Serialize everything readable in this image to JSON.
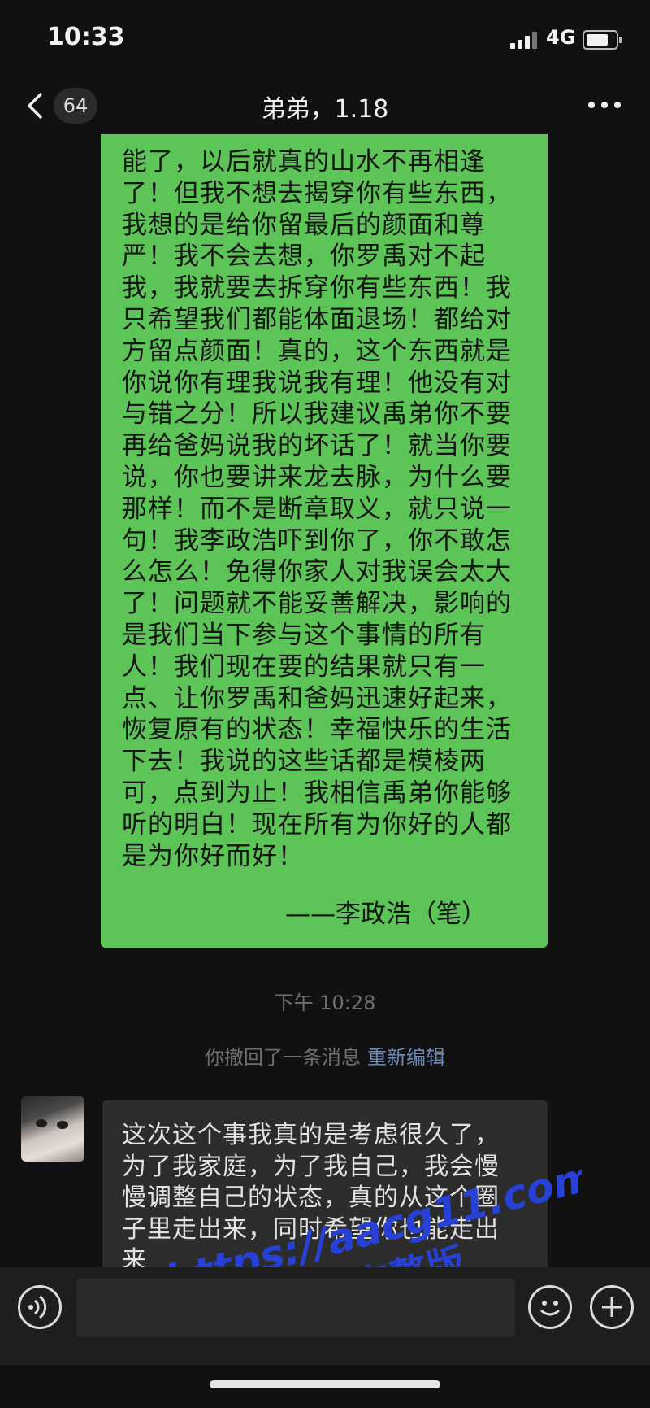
{
  "status_bar": {
    "time": "10:33",
    "network": "4G"
  },
  "nav": {
    "back_count": "64",
    "title": "弟弟，1.18"
  },
  "sent_message": {
    "lines": [
      "能了，以后就真的山水不再相逢",
      "了！但我不想去揭穿你有些东西，",
      "我想的是给你留最后的颜面和尊",
      "严！我不会去想，你罗禹对不起",
      "我，我就要去拆穿你有些东西！我",
      "只希望我们都能体面退场！都给对",
      "方留点颜面！真的，这个东西就是",
      "你说你有理我说我有理！他没有对",
      "与错之分！所以我建议禹弟你不要",
      "再给爸妈说我的坏话了！就当你要",
      "说，你也要讲来龙去脉，为什么要",
      "那样！而不是断章取义，就只说一",
      "句！我李政浩吓到你了，你不敢怎",
      "么怎么！免得你家人对我误会太大",
      "了！问题就不能妥善解决，影响的",
      "是我们当下参与这个事情的所有",
      "人！我们现在要的结果就只有一",
      "点、让你罗禹和爸妈迅速好起来，",
      "恢复原有的状态！幸福快乐的生活",
      "下去！我说的这些话都是模棱两",
      "可，点到为止！我相信禹弟你能够",
      "听的明白！现在所有为你好的人都",
      "是为你好而好！"
    ],
    "signature": "——李政浩（笔）"
  },
  "timestamp": "下午 10:28",
  "system_note": {
    "text": "你撤回了一条消息",
    "re_edit": "重新编辑"
  },
  "received_message": {
    "lines": [
      "这次这个事我真的是考虑很久了，",
      "为了我家庭，为了我自己，我会慢",
      "慢调整自己的状态，真的从这个圈",
      "子里走出来，同时希望你也能走出",
      "来"
    ]
  },
  "watermark": {
    "line1": "https://aacg11.com",
    "line2": "看完整版"
  },
  "colors": {
    "sent_bubble": "#5dc457",
    "received_bubble": "#2c2c2c",
    "background": "#111111",
    "link": "#6b8ab8",
    "watermark": "#2741d8"
  },
  "icons": [
    "chevron-left-icon",
    "more-icon",
    "voice-icon",
    "emoji-icon",
    "plus-icon"
  ]
}
